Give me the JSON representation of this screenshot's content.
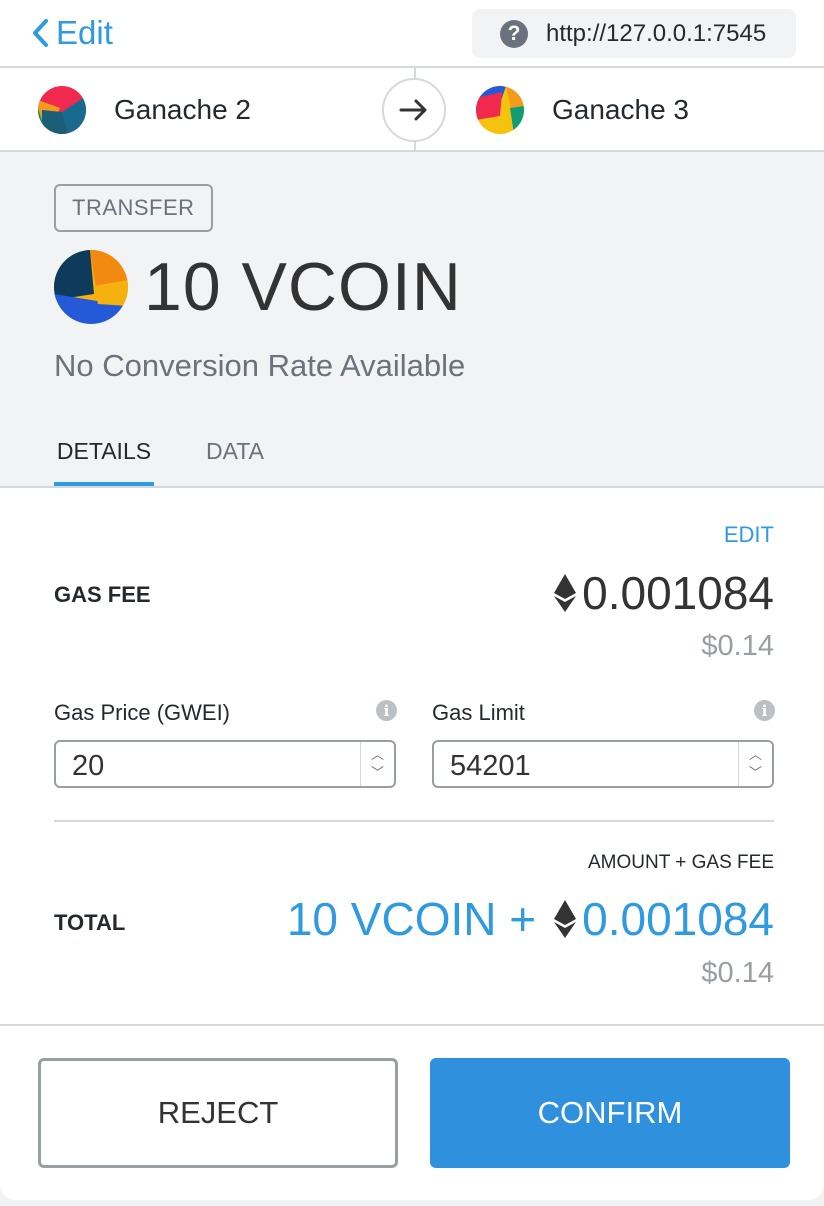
{
  "header": {
    "back_label": "Edit",
    "origin_url": "http://127.0.0.1:7545"
  },
  "accounts": {
    "from_name": "Ganache 2",
    "to_name": "Ganache 3"
  },
  "summary": {
    "action_badge": "TRANSFER",
    "amount": "10 VCOIN",
    "conversion_note": "No Conversion Rate Available"
  },
  "tabs": [
    {
      "label": "DETAILS",
      "active": true
    },
    {
      "label": "DATA",
      "active": false
    }
  ],
  "details": {
    "edit_label": "EDIT",
    "gas_fee_label": "GAS FEE",
    "gas_fee_eth": "0.001084",
    "gas_fee_fiat": "$0.14",
    "gas_price_label": "Gas Price (GWEI)",
    "gas_price_value": "20",
    "gas_limit_label": "Gas Limit",
    "gas_limit_value": "54201",
    "amount_gas_label": "AMOUNT + GAS FEE",
    "total_label": "TOTAL",
    "total_token": "10 VCOIN +",
    "total_eth": "0.001084",
    "total_fiat": "$0.14"
  },
  "buttons": {
    "reject": "REJECT",
    "confirm": "CONFIRM"
  },
  "colors": {
    "accent": "#2f9ae0",
    "confirm_bg": "#2f91dd",
    "summary_bg": "#f2f3f4"
  }
}
